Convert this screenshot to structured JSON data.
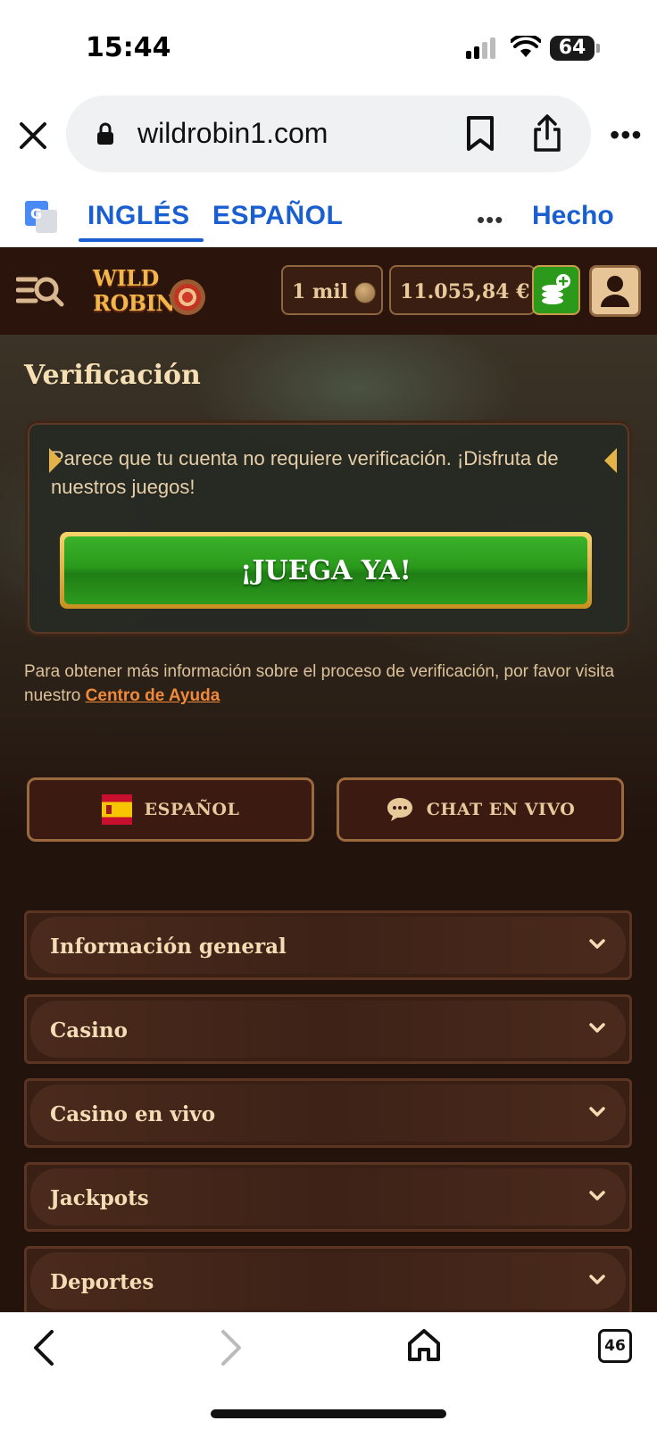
{
  "status_bar": {
    "time": "15:44",
    "battery": "64"
  },
  "browser": {
    "url": "wildrobin1.com"
  },
  "translate_bar": {
    "lang_source": "INGLÉS",
    "lang_target": "ESPAÑOL",
    "done": "Hecho"
  },
  "header": {
    "logo_line1": "WILD",
    "logo_line2": "ROBIN",
    "coins": "1 mil",
    "balance": "11.055,84 €"
  },
  "main": {
    "title": "Verificación",
    "message": "Parece que tu cuenta no requiere verificación. ¡Disfruta de nuestros juegos!",
    "play_button": "¡JUEGA YA!",
    "info_text": "Para obtener más información sobre el proceso de verificación, por favor visita nuestro",
    "help_link": "Centro de Ayuda",
    "language_button": "ESPAÑOL",
    "chat_button": "CHAT EN VIVO",
    "accordions": [
      "Información general",
      "Casino",
      "Casino en vivo",
      "Jackpots",
      "Deportes"
    ]
  },
  "bottom_bar": {
    "tabs_count": "46"
  },
  "colors": {
    "accent_blue": "#1a5fd1",
    "green_button": "#2a9a1c",
    "gold": "#e8c99b",
    "link_orange": "#f08a3a",
    "header_bg": "#2a140c"
  }
}
